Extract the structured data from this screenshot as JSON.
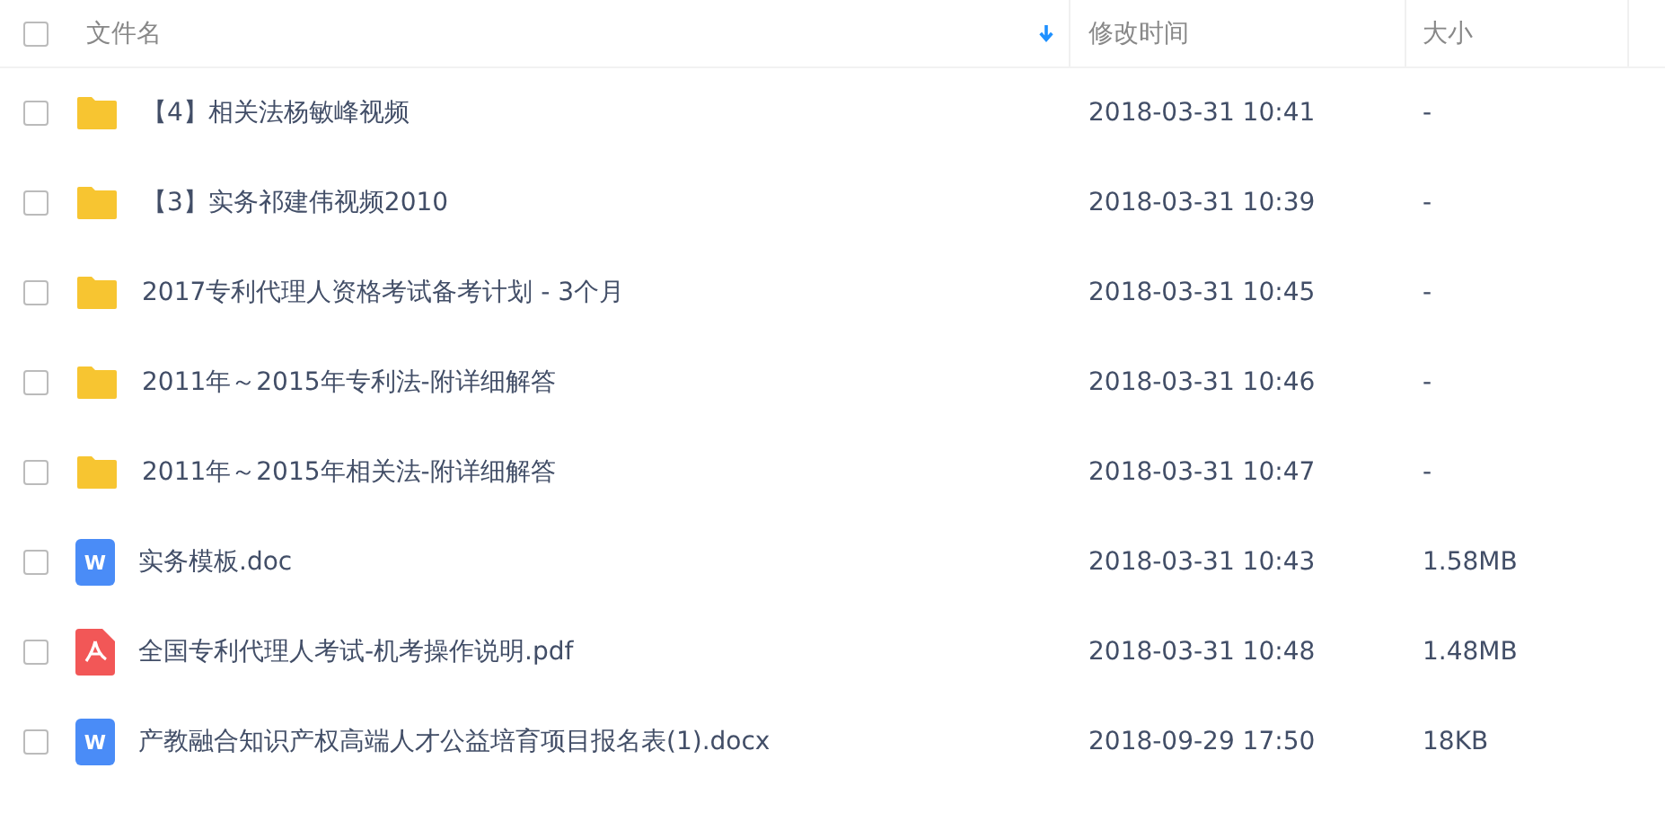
{
  "header": {
    "checked": false,
    "columns": [
      {
        "label": "文件名",
        "sorted": true
      },
      {
        "label": "修改时间",
        "sorted": false
      },
      {
        "label": "大小",
        "sorted": false
      }
    ]
  },
  "rows": [
    {
      "kind": "folder",
      "name": "【4】相关法杨敏峰视频",
      "modified": "2018-03-31 10:41",
      "size": "-",
      "checked": false
    },
    {
      "kind": "folder",
      "name": "【3】实务祁建伟视频2010",
      "modified": "2018-03-31 10:39",
      "size": "-",
      "checked": false
    },
    {
      "kind": "folder",
      "name": "2017专利代理人资格考试备考计划 - 3个月",
      "modified": "2018-03-31 10:45",
      "size": "-",
      "checked": false
    },
    {
      "kind": "folder",
      "name": "2011年～2015年专利法-附详细解答",
      "modified": "2018-03-31 10:46",
      "size": "-",
      "checked": false
    },
    {
      "kind": "folder",
      "name": "2011年～2015年相关法-附详细解答",
      "modified": "2018-03-31 10:47",
      "size": "-",
      "checked": false
    },
    {
      "kind": "doc",
      "badge": "W",
      "name": "实务模板.doc",
      "modified": "2018-03-31 10:43",
      "size": "1.58MB",
      "checked": false
    },
    {
      "kind": "pdf",
      "name": "全国专利代理人考试-机考操作说明.pdf",
      "modified": "2018-03-31 10:48",
      "size": "1.48MB",
      "checked": false
    },
    {
      "kind": "doc",
      "badge": "W",
      "name": "产教融合知识产权高端人才公益培育项目报名表(1).docx",
      "modified": "2018-09-29 17:50",
      "size": "18KB",
      "checked": false
    }
  ]
}
